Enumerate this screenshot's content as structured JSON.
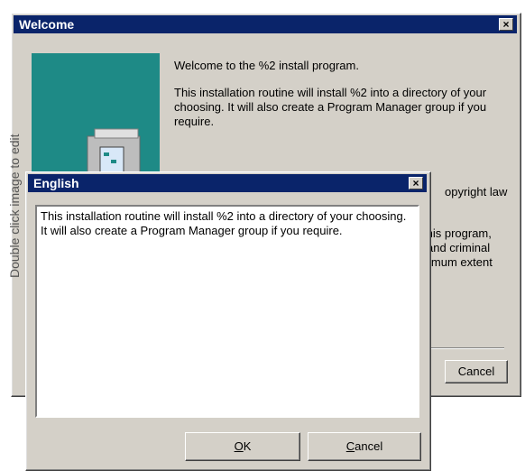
{
  "welcome": {
    "title": "Welcome",
    "close_glyph": "×",
    "heading": "Welcome to the %2 install program.",
    "paragraph": "This installation routine will install %2 into a directory of your choosing. It will also create a Program Manager group if you require.",
    "copyright_fragment": "opyright law",
    "warn_line1": "this program,",
    "warn_line2": "and criminal",
    "warn_line3": "imum extent",
    "cancel_label": "Cancel",
    "side_watermark": "Double click image to edit",
    "colors": {
      "title_bar": "#0a246a",
      "banner": "#1e8a86"
    }
  },
  "english": {
    "title": "English",
    "close_glyph": "×",
    "text": "This installation routine will install %2 into a directory of your choosing. It will also create a Program Manager group if you require.",
    "ok_mnemonic": "O",
    "ok_rest": "K",
    "cancel_mnemonic": "C",
    "cancel_rest": "ancel"
  }
}
